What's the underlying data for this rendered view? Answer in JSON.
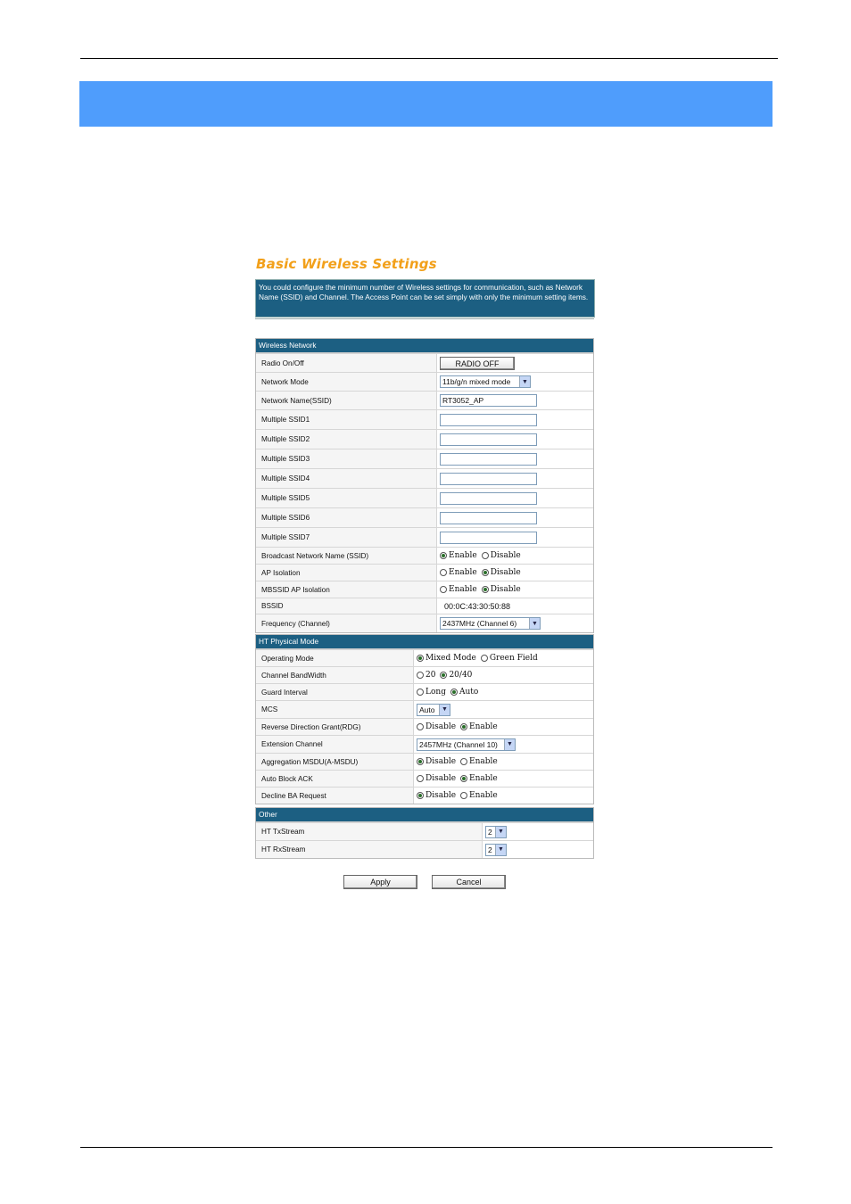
{
  "page": {
    "title": "Basic Wireless Settings",
    "intro": "You could configure the minimum number of Wireless settings for communication, such as Network Name (SSID) and Channel. The Access Point can be set simply with only the minimum setting items."
  },
  "wireless": {
    "heading": "Wireless Network",
    "radio_label": "Radio On/Off",
    "radio_button": "RADIO OFF",
    "mode_label": "Network Mode",
    "mode_value": "11b/g/n mixed mode",
    "ssid_label": "Network Name(SSID)",
    "ssid_value": "RT3052_AP",
    "mssid_labels": [
      "Multiple SSID1",
      "Multiple SSID2",
      "Multiple SSID3",
      "Multiple SSID4",
      "Multiple SSID5",
      "Multiple SSID6",
      "Multiple SSID7"
    ],
    "broadcast_label": "Broadcast Network Name (SSID)",
    "ap_isolation_label": "AP Isolation",
    "mbssid_label": "MBSSID AP Isolation",
    "bssid_label": "BSSID",
    "bssid_value": "00:0C:43:30:50:88",
    "freq_label": "Frequency (Channel)",
    "freq_value": "2437MHz (Channel 6)",
    "enable": "Enable",
    "disable": "Disable"
  },
  "ht": {
    "heading": "HT Physical Mode",
    "op_label": "Operating Mode",
    "op_mixed": "Mixed Mode",
    "op_green": "Green Field",
    "bw_label": "Channel BandWidth",
    "bw_20": "20",
    "bw_2040": "20/40",
    "gi_label": "Guard Interval",
    "gi_long": "Long",
    "gi_auto": "Auto",
    "mcs_label": "MCS",
    "mcs_value": "Auto",
    "rdg_label": "Reverse Direction Grant(RDG)",
    "ext_label": "Extension Channel",
    "ext_value": "2457MHz (Channel 10)",
    "amsdu_label": "Aggregation MSDU(A-MSDU)",
    "autoba_label": "Auto Block ACK",
    "declineba_label": "Decline BA Request",
    "enable": "Enable",
    "disable": "Disable"
  },
  "other": {
    "heading": "Other",
    "tx_label": "HT TxStream",
    "tx_value": "2",
    "rx_label": "HT RxStream",
    "rx_value": "2"
  },
  "buttons": {
    "apply": "Apply",
    "cancel": "Cancel"
  }
}
